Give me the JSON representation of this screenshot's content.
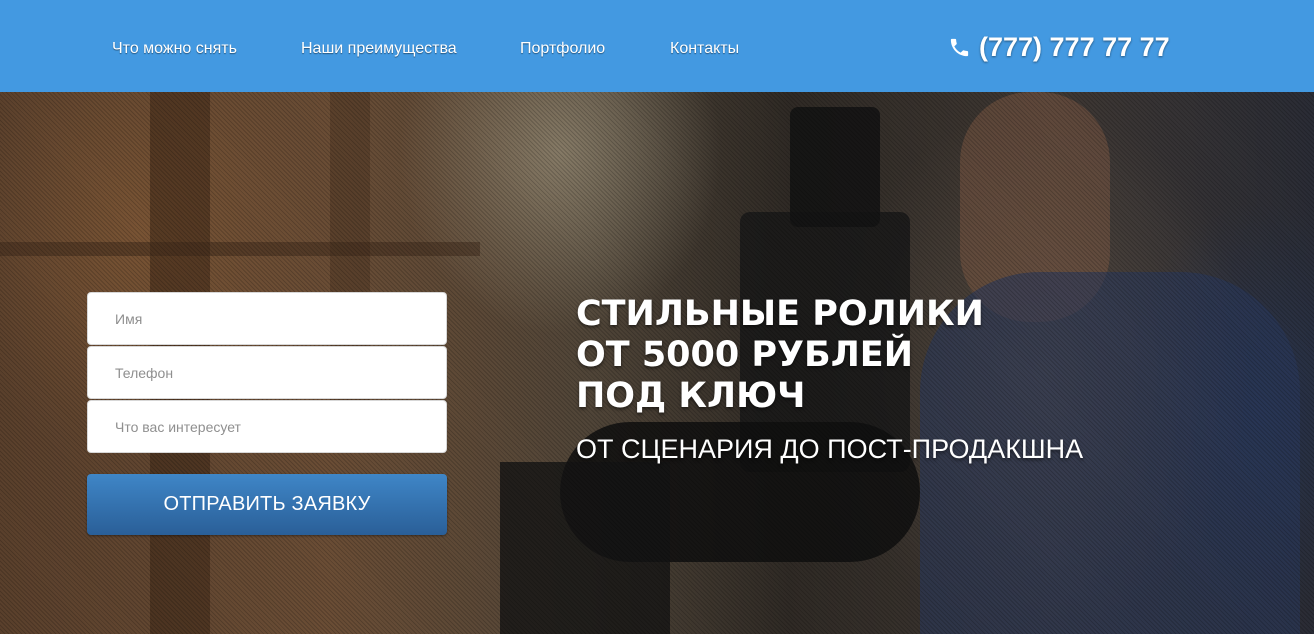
{
  "nav": {
    "items": [
      {
        "label": "Что можно снять"
      },
      {
        "label": "Наши преимущества"
      },
      {
        "label": "Портфолио"
      },
      {
        "label": "Контакты"
      }
    ],
    "phone": "(777) 777 77 77",
    "phone_icon": "phone-icon"
  },
  "form": {
    "name_placeholder": "Имя",
    "phone_placeholder": "Телефон",
    "interest_placeholder": "Что вас интересует",
    "submit_label": "ОТПРАВИТЬ ЗАЯВКУ"
  },
  "hero": {
    "headline": [
      "СТИЛЬНЫЕ РОЛИКИ",
      "ОТ 5000 РУБЛЕЙ",
      "ПОД КЛЮЧ"
    ],
    "subheadline": "ОТ СЦЕНАРИЯ ДО ПОСТ-ПРОДАКШНА"
  },
  "colors": {
    "header_bg": "#4399e1",
    "button_top": "#3f86c7",
    "button_bottom": "#2a5f98",
    "text": "#ffffff"
  }
}
